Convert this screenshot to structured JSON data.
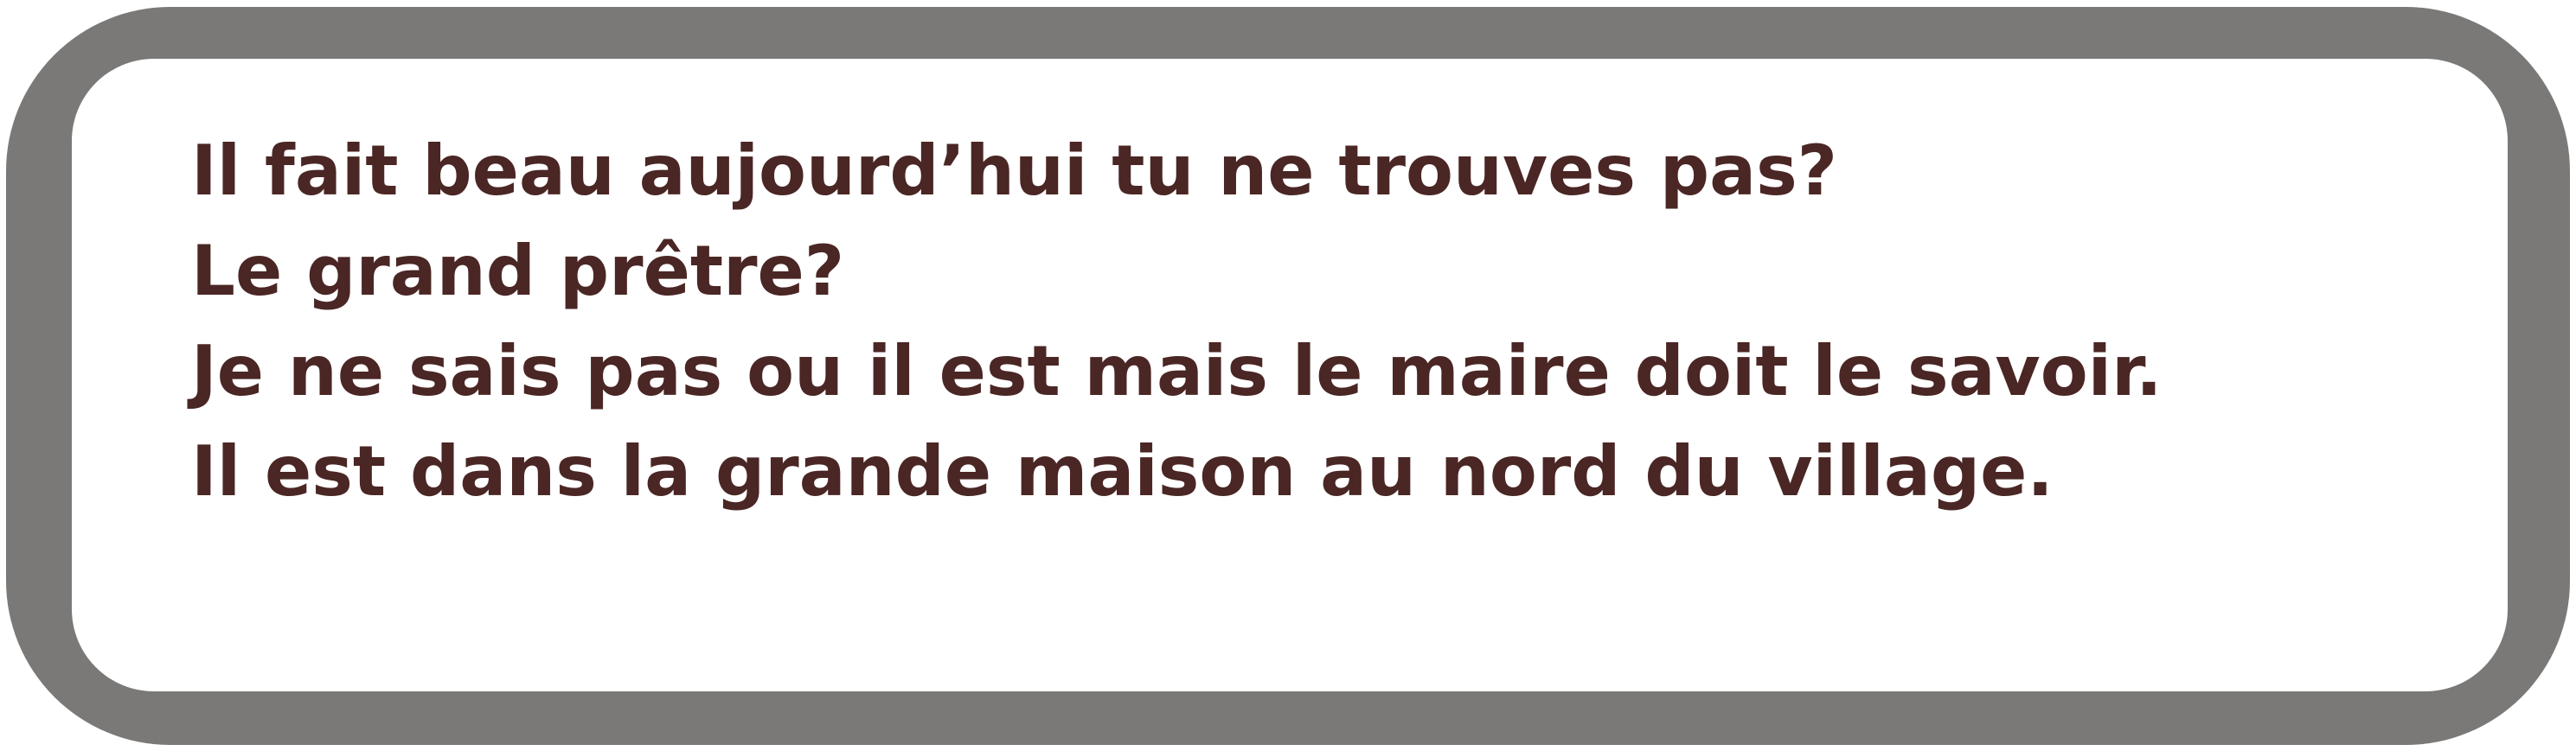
{
  "colors": {
    "frame": "#7a7978",
    "panel": "#ffffff",
    "text": "#4a2624"
  },
  "dialog": {
    "lines": [
      "Il fait beau aujourd’hui tu ne trouves pas?",
      "Le grand prêtre?",
      "Je ne sais pas ou il est mais le maire doit le savoir.",
      "Il est dans la grande maison au nord du village."
    ]
  }
}
